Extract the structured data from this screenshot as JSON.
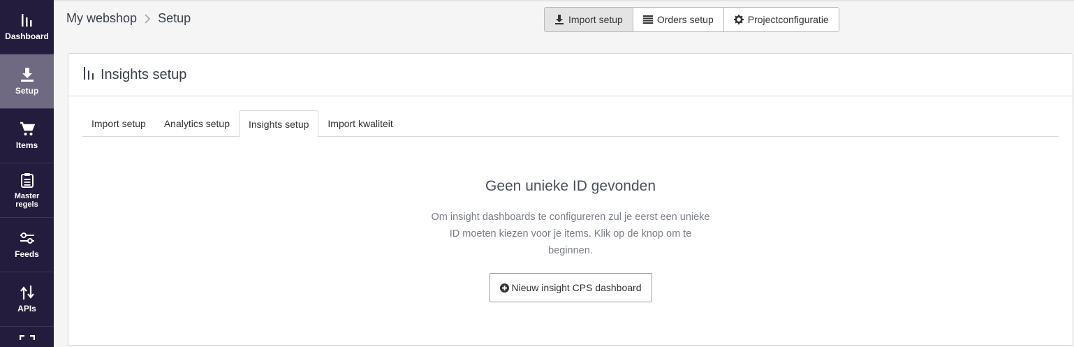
{
  "sidebar": {
    "items": [
      {
        "label": "Dashboard",
        "icon": "bar-chart-icon"
      },
      {
        "label": "Setup",
        "icon": "download-icon",
        "active": true
      },
      {
        "label": "Items",
        "icon": "cart-icon"
      },
      {
        "label": "Master regels",
        "icon": "clipboard-icon"
      },
      {
        "label": "Feeds",
        "icon": "sliders-icon"
      },
      {
        "label": "APIs",
        "icon": "swap-vertical-icon"
      }
    ]
  },
  "header": {
    "breadcrumb": [
      "My webshop",
      "Setup"
    ],
    "buttons": [
      {
        "label": "Import setup",
        "icon": "download-icon",
        "active": true
      },
      {
        "label": "Orders setup",
        "icon": "list-icon"
      },
      {
        "label": "Projectconfiguratie",
        "icon": "gear-icon"
      }
    ]
  },
  "card": {
    "title": "Insights setup",
    "tabs": [
      "Import setup",
      "Analytics setup",
      "Insights setup",
      "Import kwaliteit"
    ],
    "active_tab": "Insights setup"
  },
  "empty_state": {
    "title": "Geen unieke ID gevonden",
    "text": "Om insight dashboards te configureren zul je eerst een unieke ID moeten kiezen voor je items. Klik op de knop om te beginnen.",
    "button_label": "Nieuw insight CPS dashboard"
  },
  "colors": {
    "sidebar_bg": "#231c3d",
    "sidebar_active": "#6f6a82"
  }
}
